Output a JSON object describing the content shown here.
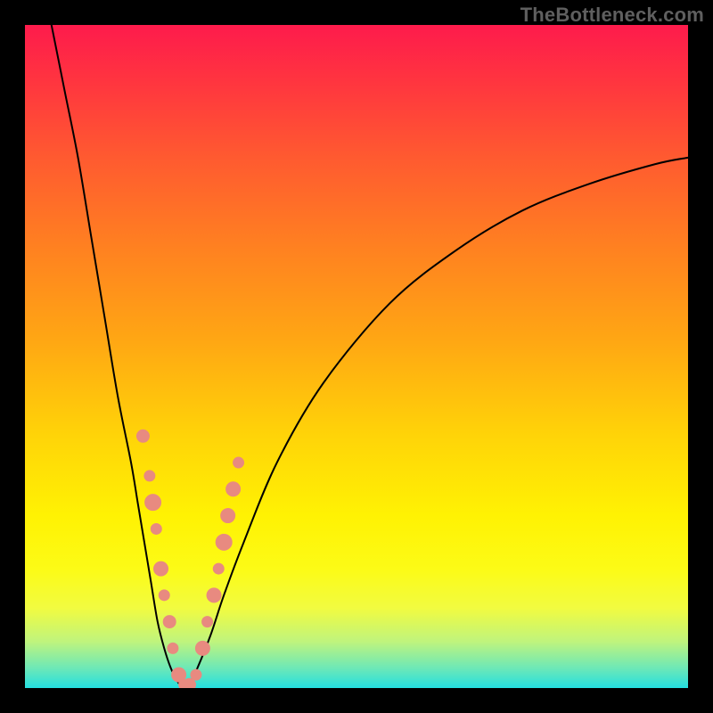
{
  "watermark": "TheBottleneck.com",
  "colors": {
    "page_bg": "#000000",
    "curve_stroke": "#000000",
    "marker_fill": "#e88a80",
    "marker_stroke": "#e88a80"
  },
  "chart_data": {
    "type": "line",
    "title": "",
    "xlabel": "",
    "ylabel": "",
    "xlim": [
      0,
      100
    ],
    "ylim": [
      0,
      100
    ],
    "grid": false,
    "legend": null,
    "series": [
      {
        "name": "bottleneck-curve",
        "x": [
          4,
          6,
          8,
          10,
          12,
          14,
          16,
          17,
          18,
          19,
          20,
          21,
          22,
          23,
          24,
          25,
          26,
          28,
          30,
          33,
          38,
          45,
          55,
          65,
          75,
          85,
          95,
          100
        ],
        "y": [
          100,
          90,
          80,
          68,
          56,
          44,
          34,
          28,
          22,
          16,
          10,
          6,
          3,
          1,
          0,
          1,
          3,
          8,
          14,
          22,
          34,
          46,
          58,
          66,
          72,
          76,
          79,
          80
        ]
      }
    ],
    "markers": [
      {
        "x": 17.8,
        "y": 38,
        "r": 7
      },
      {
        "x": 18.8,
        "y": 32,
        "r": 6
      },
      {
        "x": 19.3,
        "y": 28,
        "r": 9
      },
      {
        "x": 19.8,
        "y": 24,
        "r": 6
      },
      {
        "x": 20.5,
        "y": 18,
        "r": 8
      },
      {
        "x": 21.0,
        "y": 14,
        "r": 6
      },
      {
        "x": 21.8,
        "y": 10,
        "r": 7
      },
      {
        "x": 22.3,
        "y": 6,
        "r": 6
      },
      {
        "x": 23.2,
        "y": 2,
        "r": 8
      },
      {
        "x": 24.0,
        "y": 0.5,
        "r": 6
      },
      {
        "x": 24.8,
        "y": 0.5,
        "r": 7
      },
      {
        "x": 25.8,
        "y": 2,
        "r": 6
      },
      {
        "x": 26.8,
        "y": 6,
        "r": 8
      },
      {
        "x": 27.5,
        "y": 10,
        "r": 6
      },
      {
        "x": 28.5,
        "y": 14,
        "r": 8
      },
      {
        "x": 29.2,
        "y": 18,
        "r": 6
      },
      {
        "x": 30.0,
        "y": 22,
        "r": 9
      },
      {
        "x": 30.6,
        "y": 26,
        "r": 8
      },
      {
        "x": 31.4,
        "y": 30,
        "r": 8
      },
      {
        "x": 32.2,
        "y": 34,
        "r": 6
      }
    ]
  }
}
